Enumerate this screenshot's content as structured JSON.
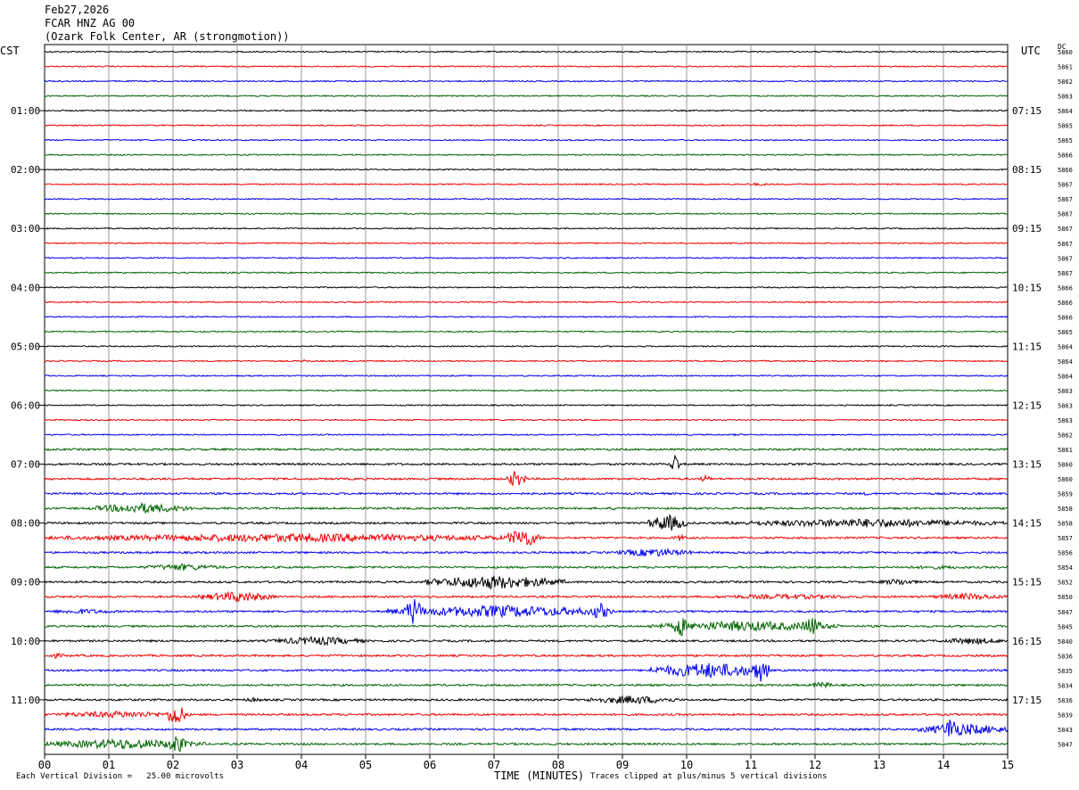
{
  "header": {
    "date": "Feb27,2026",
    "station": "FCAR HNZ AG 00",
    "location": "(Ozark Folk Center, AR (strongmotion))"
  },
  "chart_data": {
    "type": "line",
    "title": "FCAR HNZ AG 00",
    "left_zone": "CST",
    "right_zone": "UTC",
    "dc_header": "DC",
    "xlabel": "TIME (MINUTES)",
    "x_ticks": [
      "00",
      "01",
      "02",
      "03",
      "04",
      "05",
      "06",
      "07",
      "08",
      "09",
      "10",
      "11",
      "12",
      "13",
      "14",
      "15"
    ],
    "xlim": [
      0,
      15
    ],
    "rows": 48,
    "row_minutes": 15,
    "trace_colors": [
      "#000000",
      "#ee0000",
      "#0000ee",
      "#006400"
    ],
    "left_hour_labels": [
      {
        "row": 4,
        "label": "01:00"
      },
      {
        "row": 8,
        "label": "02:00"
      },
      {
        "row": 12,
        "label": "03:00"
      },
      {
        "row": 16,
        "label": "04:00"
      },
      {
        "row": 20,
        "label": "05:00"
      },
      {
        "row": 24,
        "label": "06:00"
      },
      {
        "row": 28,
        "label": "07:00"
      },
      {
        "row": 32,
        "label": "08:00"
      },
      {
        "row": 36,
        "label": "09:00"
      },
      {
        "row": 40,
        "label": "10:00"
      },
      {
        "row": 44,
        "label": "11:00"
      }
    ],
    "right_hour_labels": [
      {
        "row": 4,
        "label": "07:15"
      },
      {
        "row": 8,
        "label": "08:15"
      },
      {
        "row": 12,
        "label": "09:15"
      },
      {
        "row": 16,
        "label": "10:15"
      },
      {
        "row": 20,
        "label": "11:15"
      },
      {
        "row": 24,
        "label": "12:15"
      },
      {
        "row": 28,
        "label": "13:15"
      },
      {
        "row": 32,
        "label": "14:15"
      },
      {
        "row": 36,
        "label": "15:15"
      },
      {
        "row": 40,
        "label": "16:15"
      },
      {
        "row": 44,
        "label": "17:15"
      }
    ],
    "dc_values": [
      "5860",
      "5861",
      "5862",
      "5863",
      "5864",
      "5865",
      "5865",
      "5866",
      "5866",
      "5867",
      "5867",
      "5867",
      "5867",
      "5867",
      "5867",
      "5867",
      "5866",
      "5866",
      "5866",
      "5865",
      "5864",
      "5864",
      "5864",
      "5863",
      "5863",
      "5863",
      "5862",
      "5861",
      "5860",
      "5860",
      "5859",
      "5858",
      "5858",
      "5857",
      "5856",
      "5854",
      "5852",
      "5850",
      "5847",
      "5845",
      "5840",
      "5836",
      "5835",
      "5834",
      "5836",
      "5839",
      "5843",
      "5847"
    ],
    "events": [
      {
        "row": 1,
        "x": [
          0,
          15
        ],
        "amp": 0.6,
        "noise": true
      },
      {
        "row": 9,
        "x": [
          10.8,
          11.4
        ],
        "amp": 1.5
      },
      {
        "row": 21,
        "x": [
          4.0,
          4.1
        ],
        "amp": 2.5
      },
      {
        "row": 26,
        "x": [
          10.7,
          10.9
        ],
        "amp": 1.5
      },
      {
        "row": 28,
        "x": [
          9.75,
          9.9
        ],
        "amp": 12
      },
      {
        "row": 29,
        "x": [
          7.2,
          7.5
        ],
        "amp": 10
      },
      {
        "row": 29,
        "x": [
          10.2,
          10.4
        ],
        "amp": 4
      },
      {
        "row": 30,
        "x": [
          12.7,
          12.9
        ],
        "amp": 2
      },
      {
        "row": 31,
        "x": [
          0.7,
          2.3
        ],
        "amp": 6
      },
      {
        "row": 31,
        "x": [
          8.7,
          9.1
        ],
        "amp": 2
      },
      {
        "row": 32,
        "x": [
          9.4,
          10.0
        ],
        "amp": 10
      },
      {
        "row": 32,
        "x": [
          10.6,
          15.0
        ],
        "amp": 5
      },
      {
        "row": 33,
        "x": [
          0.0,
          7.8
        ],
        "amp": 5
      },
      {
        "row": 33,
        "x": [
          7.2,
          7.7
        ],
        "amp": 12
      },
      {
        "row": 33,
        "x": [
          9.8,
          10.0
        ],
        "amp": 4
      },
      {
        "row": 34,
        "x": [
          8.9,
          10.1
        ],
        "amp": 5
      },
      {
        "row": 35,
        "x": [
          1.5,
          2.8
        ],
        "amp": 4
      },
      {
        "row": 35,
        "x": [
          12.9,
          14.8
        ],
        "amp": 2
      },
      {
        "row": 36,
        "x": [
          5.9,
          8.1
        ],
        "amp": 8
      },
      {
        "row": 36,
        "x": [
          13.0,
          13.6
        ],
        "amp": 4
      },
      {
        "row": 37,
        "x": [
          2.4,
          3.6
        ],
        "amp": 6
      },
      {
        "row": 37,
        "x": [
          10.2,
          12.9
        ],
        "amp": 3
      },
      {
        "row": 37,
        "x": [
          13.8,
          15.0
        ],
        "amp": 4
      },
      {
        "row": 38,
        "x": [
          0.0,
          1.2
        ],
        "amp": 3
      },
      {
        "row": 38,
        "x": [
          5.3,
          8.9
        ],
        "amp": 7
      },
      {
        "row": 38,
        "x": [
          5.6,
          5.9
        ],
        "amp": 16
      },
      {
        "row": 38,
        "x": [
          8.5,
          8.8
        ],
        "amp": 10
      },
      {
        "row": 39,
        "x": [
          9.4,
          12.4
        ],
        "amp": 6
      },
      {
        "row": 39,
        "x": [
          11.8,
          12.1
        ],
        "amp": 12
      },
      {
        "row": 39,
        "x": [
          9.8,
          10.0
        ],
        "amp": 14
      },
      {
        "row": 40,
        "x": [
          3.5,
          5.0
        ],
        "amp": 5
      },
      {
        "row": 40,
        "x": [
          13.9,
          15.0
        ],
        "amp": 4
      },
      {
        "row": 41,
        "x": [
          0.0,
          0.35
        ],
        "amp": 3
      },
      {
        "row": 42,
        "x": [
          9.4,
          11.3
        ],
        "amp": 9
      },
      {
        "row": 42,
        "x": [
          11.0,
          11.3
        ],
        "amp": 14
      },
      {
        "row": 43,
        "x": [
          11.9,
          12.3
        ],
        "amp": 4
      },
      {
        "row": 44,
        "x": [
          8.4,
          9.9
        ],
        "amp": 5
      },
      {
        "row": 44,
        "x": [
          3.1,
          3.4
        ],
        "amp": 3
      },
      {
        "row": 45,
        "x": [
          0.0,
          2.3
        ],
        "amp": 4
      },
      {
        "row": 45,
        "x": [
          1.9,
          2.2
        ],
        "amp": 14
      },
      {
        "row": 46,
        "x": [
          13.6,
          15.0
        ],
        "amp": 7
      },
      {
        "row": 46,
        "x": [
          14.0,
          14.25
        ],
        "amp": 16
      },
      {
        "row": 47,
        "x": [
          0.0,
          2.5
        ],
        "amp": 6
      },
      {
        "row": 47,
        "x": [
          1.9,
          2.2
        ],
        "amp": 12
      }
    ]
  },
  "footer": {
    "left": "Each Vertical Division =   25.00 microvolts",
    "right": "Traces clipped at plus/minus 5 vertical divisions"
  }
}
